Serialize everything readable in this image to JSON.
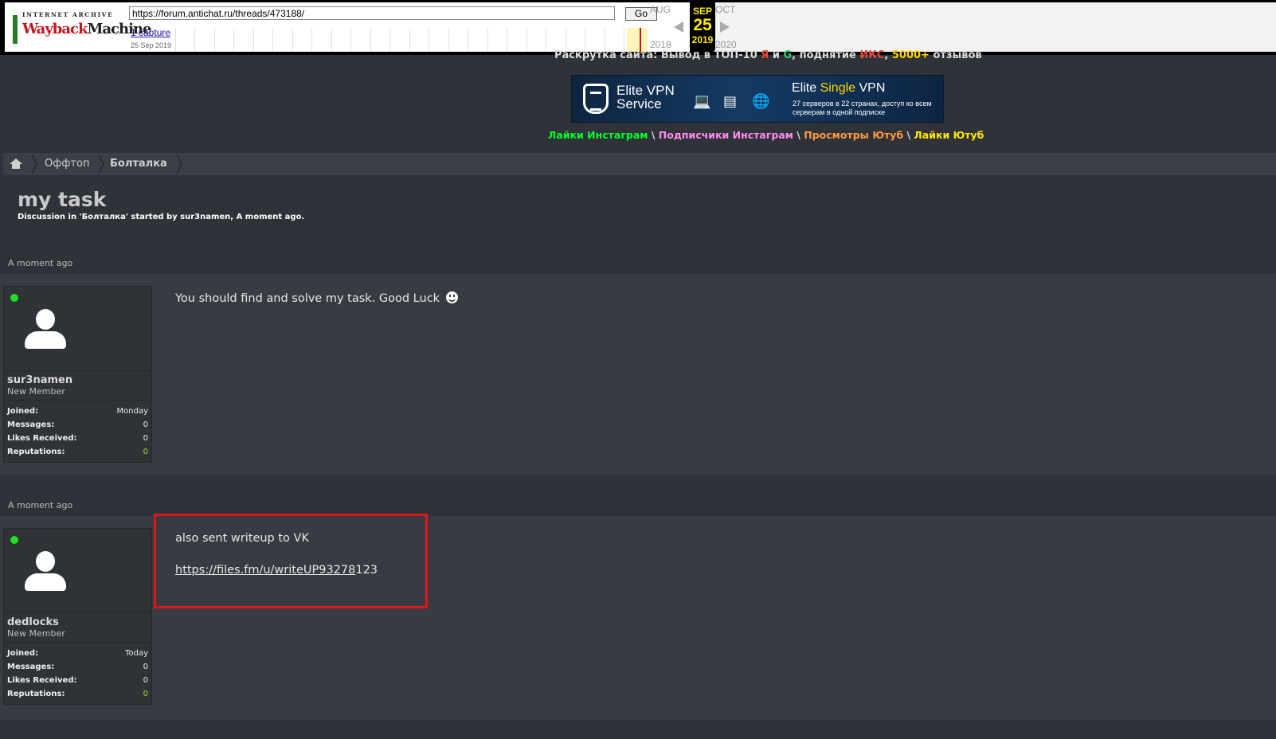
{
  "wayback": {
    "logo_top": "INTERNET ARCHIVE",
    "logo_wayback": "Wayback",
    "logo_machine": "Machine",
    "url": "https://forum.antichat.ru/threads/473188/",
    "go_label": "Go",
    "captures_label": "1 capture",
    "capture_date": "25 Sep 2019",
    "prev_month": "AUG",
    "current_month": "SEP",
    "next_month": "OCT",
    "current_day": "25",
    "prev_year": "2018",
    "current_year": "2019",
    "next_year": "2020"
  },
  "promo": {
    "line_start": "Раскрутка сайта:  Вывод в ТОП-10 ",
    "line_ya": "Я",
    "line_and": " и ",
    "line_g": "G",
    "line_mid": ", поднятие ",
    "line_iks": "ИКС",
    "line_comma": ", ",
    "line_reviews_num": "5000+",
    "line_end": " отзывов"
  },
  "banner": {
    "left_title": "Elite VPN",
    "left_sub": "Service",
    "right_title_a": "Elite ",
    "right_title_b": "Single",
    "right_title_c": " VPN",
    "right_desc": "27 серверов в 22 странах, доступ ко всем серверам  в одной подписке"
  },
  "links": {
    "a": "Лайки Инстаграм",
    "b": "Подписчики Инстаграм",
    "c": "Просмотры Ютуб",
    "d": "Лайки Ютуб",
    "sep": " \\ "
  },
  "breadcrumb": {
    "items": [
      "Оффтоп",
      "Болталка"
    ]
  },
  "thread": {
    "title": "my task",
    "description": "Discussion in 'Болталка' started by sur3namen, A moment ago."
  },
  "posts": [
    {
      "date": "A moment ago",
      "username": "sur3namen",
      "usertitle": "New Member",
      "stats": [
        {
          "k": "Joined:",
          "v": "Monday"
        },
        {
          "k": "Messages:",
          "v": "0"
        },
        {
          "k": "Likes Received:",
          "v": "0"
        },
        {
          "k": "Reputations:",
          "v": "0"
        }
      ],
      "message": "You should find and solve my task. Good Luck"
    },
    {
      "date": "A moment ago",
      "username": "dedlocks",
      "usertitle": "New Member",
      "stats": [
        {
          "k": "Joined:",
          "v": "Today"
        },
        {
          "k": "Messages:",
          "v": "0"
        },
        {
          "k": "Likes Received:",
          "v": "0"
        },
        {
          "k": "Reputations:",
          "v": "0"
        }
      ],
      "message": "also sent writeup to VK",
      "link_underlined": "https://files.fm/u/writeUP93278",
      "link_tail": "123"
    }
  ],
  "colors": {
    "online": "#1ee01e",
    "highlight_box": "#e01616",
    "reputation": "#9be02b"
  }
}
